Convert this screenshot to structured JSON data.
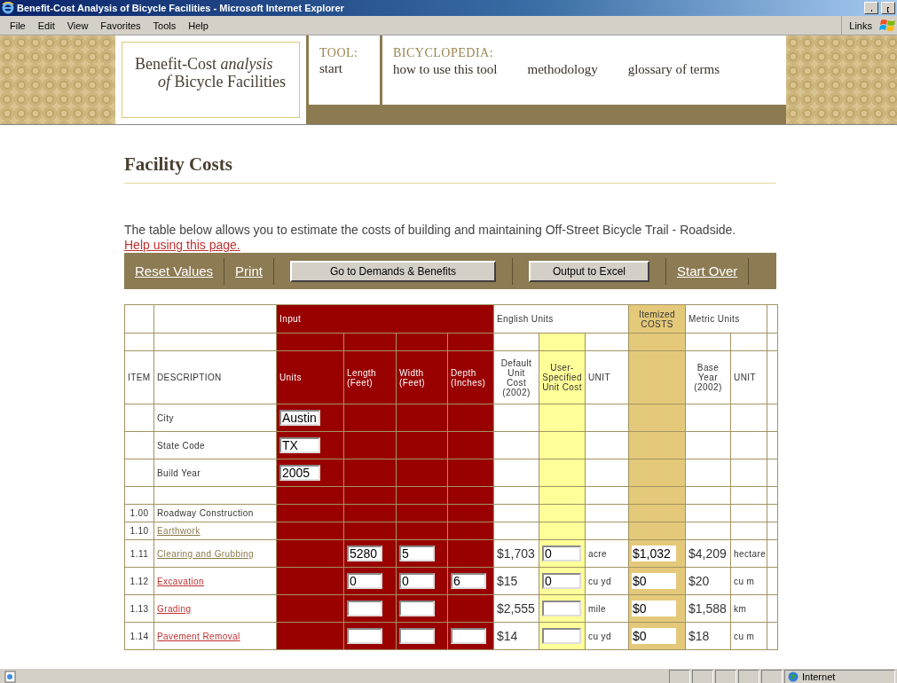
{
  "window": {
    "title": "Benefit-Cost Analysis of Bicycle Facilities - Microsoft Internet Explorer"
  },
  "menu": [
    "File",
    "Edit",
    "View",
    "Favorites",
    "Tools",
    "Help"
  ],
  "links_label": "Links",
  "header": {
    "logo_line1": "Benefit-Cost *analysis*",
    "logo_line2": "*of* Bicycle Facilities",
    "tool_label": "TOOL:",
    "tool_link": "start",
    "bicyclopedia_label": "BICYCLOPEDIA:",
    "nav": [
      "how to use this tool",
      "methodology",
      "glossary of terms"
    ]
  },
  "page": {
    "heading": "Facility Costs",
    "intro": "The table below allows you to estimate the costs of building and maintaining Off-Street Bicycle Trail - Roadside.",
    "help_link": "Help using this page."
  },
  "toolbar": [
    {
      "kind": "link",
      "label": "Reset Values"
    },
    {
      "kind": "link",
      "label": "Print"
    },
    {
      "kind": "button",
      "label": "Go to Demands & Benefits"
    },
    {
      "kind": "button",
      "label": "Output to Excel"
    },
    {
      "kind": "link",
      "label": "Start Over"
    }
  ],
  "table": {
    "groups": {
      "input": "Input",
      "english": "English Units",
      "itemized": "Itemized COSTS",
      "metric": "Metric Units"
    },
    "columns": {
      "item": "ITEM",
      "description": "DESCRIPTION",
      "units": "Units",
      "length": "Length (Feet)",
      "width": "Width (Feet)",
      "depth": "Depth (Inches)",
      "default_cost": "Default Unit Cost (2002)",
      "user_cost": "User-Specified Unit Cost",
      "unit": "UNIT",
      "base_year": "Base Year (2002)",
      "metric_unit": "UNIT"
    },
    "rows": [
      {
        "kind": "setting",
        "description": "City",
        "units": {
          "field": true,
          "value": "Austin"
        }
      },
      {
        "kind": "setting",
        "description": "State Code",
        "units": {
          "field": true,
          "value": "TX"
        }
      },
      {
        "kind": "setting",
        "description": "Build Year",
        "units": {
          "field": true,
          "value": "2005"
        }
      },
      {
        "kind": "spacer"
      },
      {
        "kind": "section",
        "item": "1.00",
        "description": "Roadway Construction"
      },
      {
        "kind": "link",
        "item": "1.10",
        "description": "Earthwork",
        "visited": true
      },
      {
        "kind": "cost",
        "item": "1.11",
        "description": "Clearing and Grubbing",
        "visited": true,
        "length": {
          "field": true,
          "value": "5280"
        },
        "width": {
          "field": true,
          "value": "5"
        },
        "default_cost": "$1,703",
        "user_cost": {
          "field": true,
          "value": "0"
        },
        "unit": "acre",
        "itemized": "$1,032",
        "base_year": "$4,209",
        "metric_unit": "hectare"
      },
      {
        "kind": "cost",
        "item": "1.12",
        "description": "Excavation",
        "visited": false,
        "length": {
          "field": true,
          "value": "0"
        },
        "width": {
          "field": true,
          "value": "0"
        },
        "depth": {
          "field": true,
          "value": "6"
        },
        "default_cost": "$15",
        "user_cost": {
          "field": true,
          "value": "0"
        },
        "unit": "cu yd",
        "itemized": "$0",
        "base_year": "$20",
        "metric_unit": "cu m"
      },
      {
        "kind": "cost",
        "item": "1.13",
        "description": "Grading",
        "visited": false,
        "length": {
          "field": true
        },
        "width": {
          "field": true
        },
        "default_cost": "$2,555",
        "user_cost": {
          "field": true
        },
        "unit": "mile",
        "itemized": "$0",
        "base_year": "$1,588",
        "metric_unit": "km"
      },
      {
        "kind": "cost",
        "item": "1.14",
        "description": "Pavement Removal",
        "visited": false,
        "length": {
          "field": true
        },
        "width": {
          "field": true
        },
        "depth": {
          "field": true
        },
        "default_cost": "$14",
        "user_cost": {
          "field": true
        },
        "unit": "cu yd",
        "itemized": "$0",
        "base_year": "$18",
        "metric_unit": "cu m"
      }
    ]
  },
  "status_bar": {
    "zone": "Internet"
  }
}
